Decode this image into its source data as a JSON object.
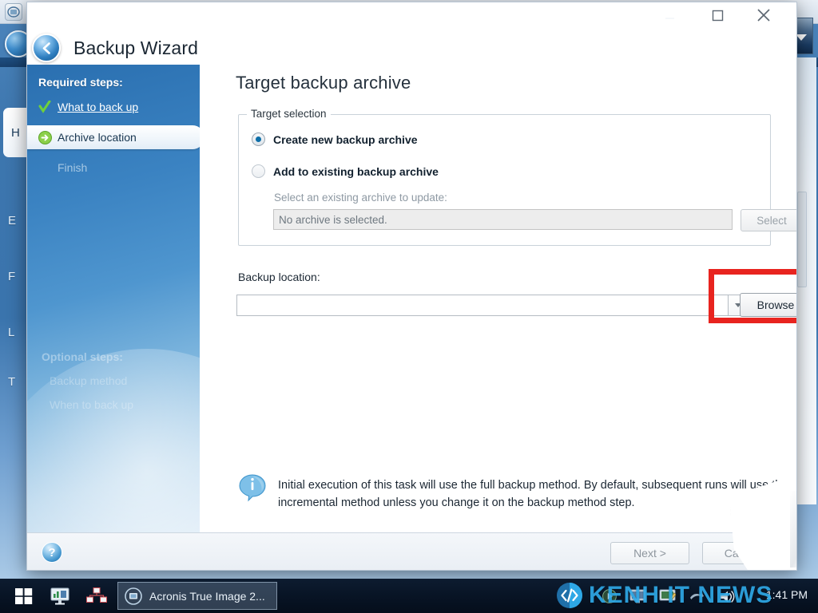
{
  "window": {
    "title": "Backup Wizard",
    "controls": {
      "minimize": "minimize-icon",
      "maximize": "maximize-icon",
      "close": "close-icon"
    }
  },
  "sidebar": {
    "required_heading": "Required steps:",
    "steps": [
      {
        "label": "What to back up",
        "state": "done",
        "icon": "check-icon"
      },
      {
        "label": "Archive location",
        "state": "current",
        "icon": "arrow-right-icon"
      },
      {
        "label": "Finish",
        "state": "disabled",
        "icon": ""
      }
    ],
    "optional_heading": "Optional steps:",
    "optional_steps": [
      {
        "label": "Backup method"
      },
      {
        "label": "When to back up"
      }
    ]
  },
  "content": {
    "page_title": "Target backup archive",
    "target_group": {
      "legend": "Target selection",
      "options": [
        {
          "label": "Create new backup archive",
          "selected": true
        },
        {
          "label": "Add to existing backup archive",
          "selected": false
        }
      ],
      "sub_label": "Select an existing archive to update:",
      "archive_field_value": "No archive is selected.",
      "select_button": "Select"
    },
    "backup_location": {
      "label": "Backup location:",
      "combo_value": "",
      "browse_button": "Browse"
    },
    "info_note": "Initial execution of this task will use the full backup method. By default, subsequent runs will use the incremental method unless you change it on the backup method step."
  },
  "footer": {
    "help": "?",
    "next_button": "Next >",
    "cancel_button": "Cancel"
  },
  "taskbar": {
    "start": "windows-start-icon",
    "task_button_label": "Acronis True Image 2...",
    "clock": "1:41 PM"
  },
  "watermark": {
    "text": "KENH IT NEWS"
  },
  "background_app": {
    "nav_letters": [
      "H",
      "E",
      "F",
      "L",
      "T"
    ]
  },
  "colors": {
    "highlight_red": "#e8241f",
    "sidebar_blue": "#3b83c2",
    "accent_blue": "#2ea8e6",
    "taskbar": "#081425"
  }
}
